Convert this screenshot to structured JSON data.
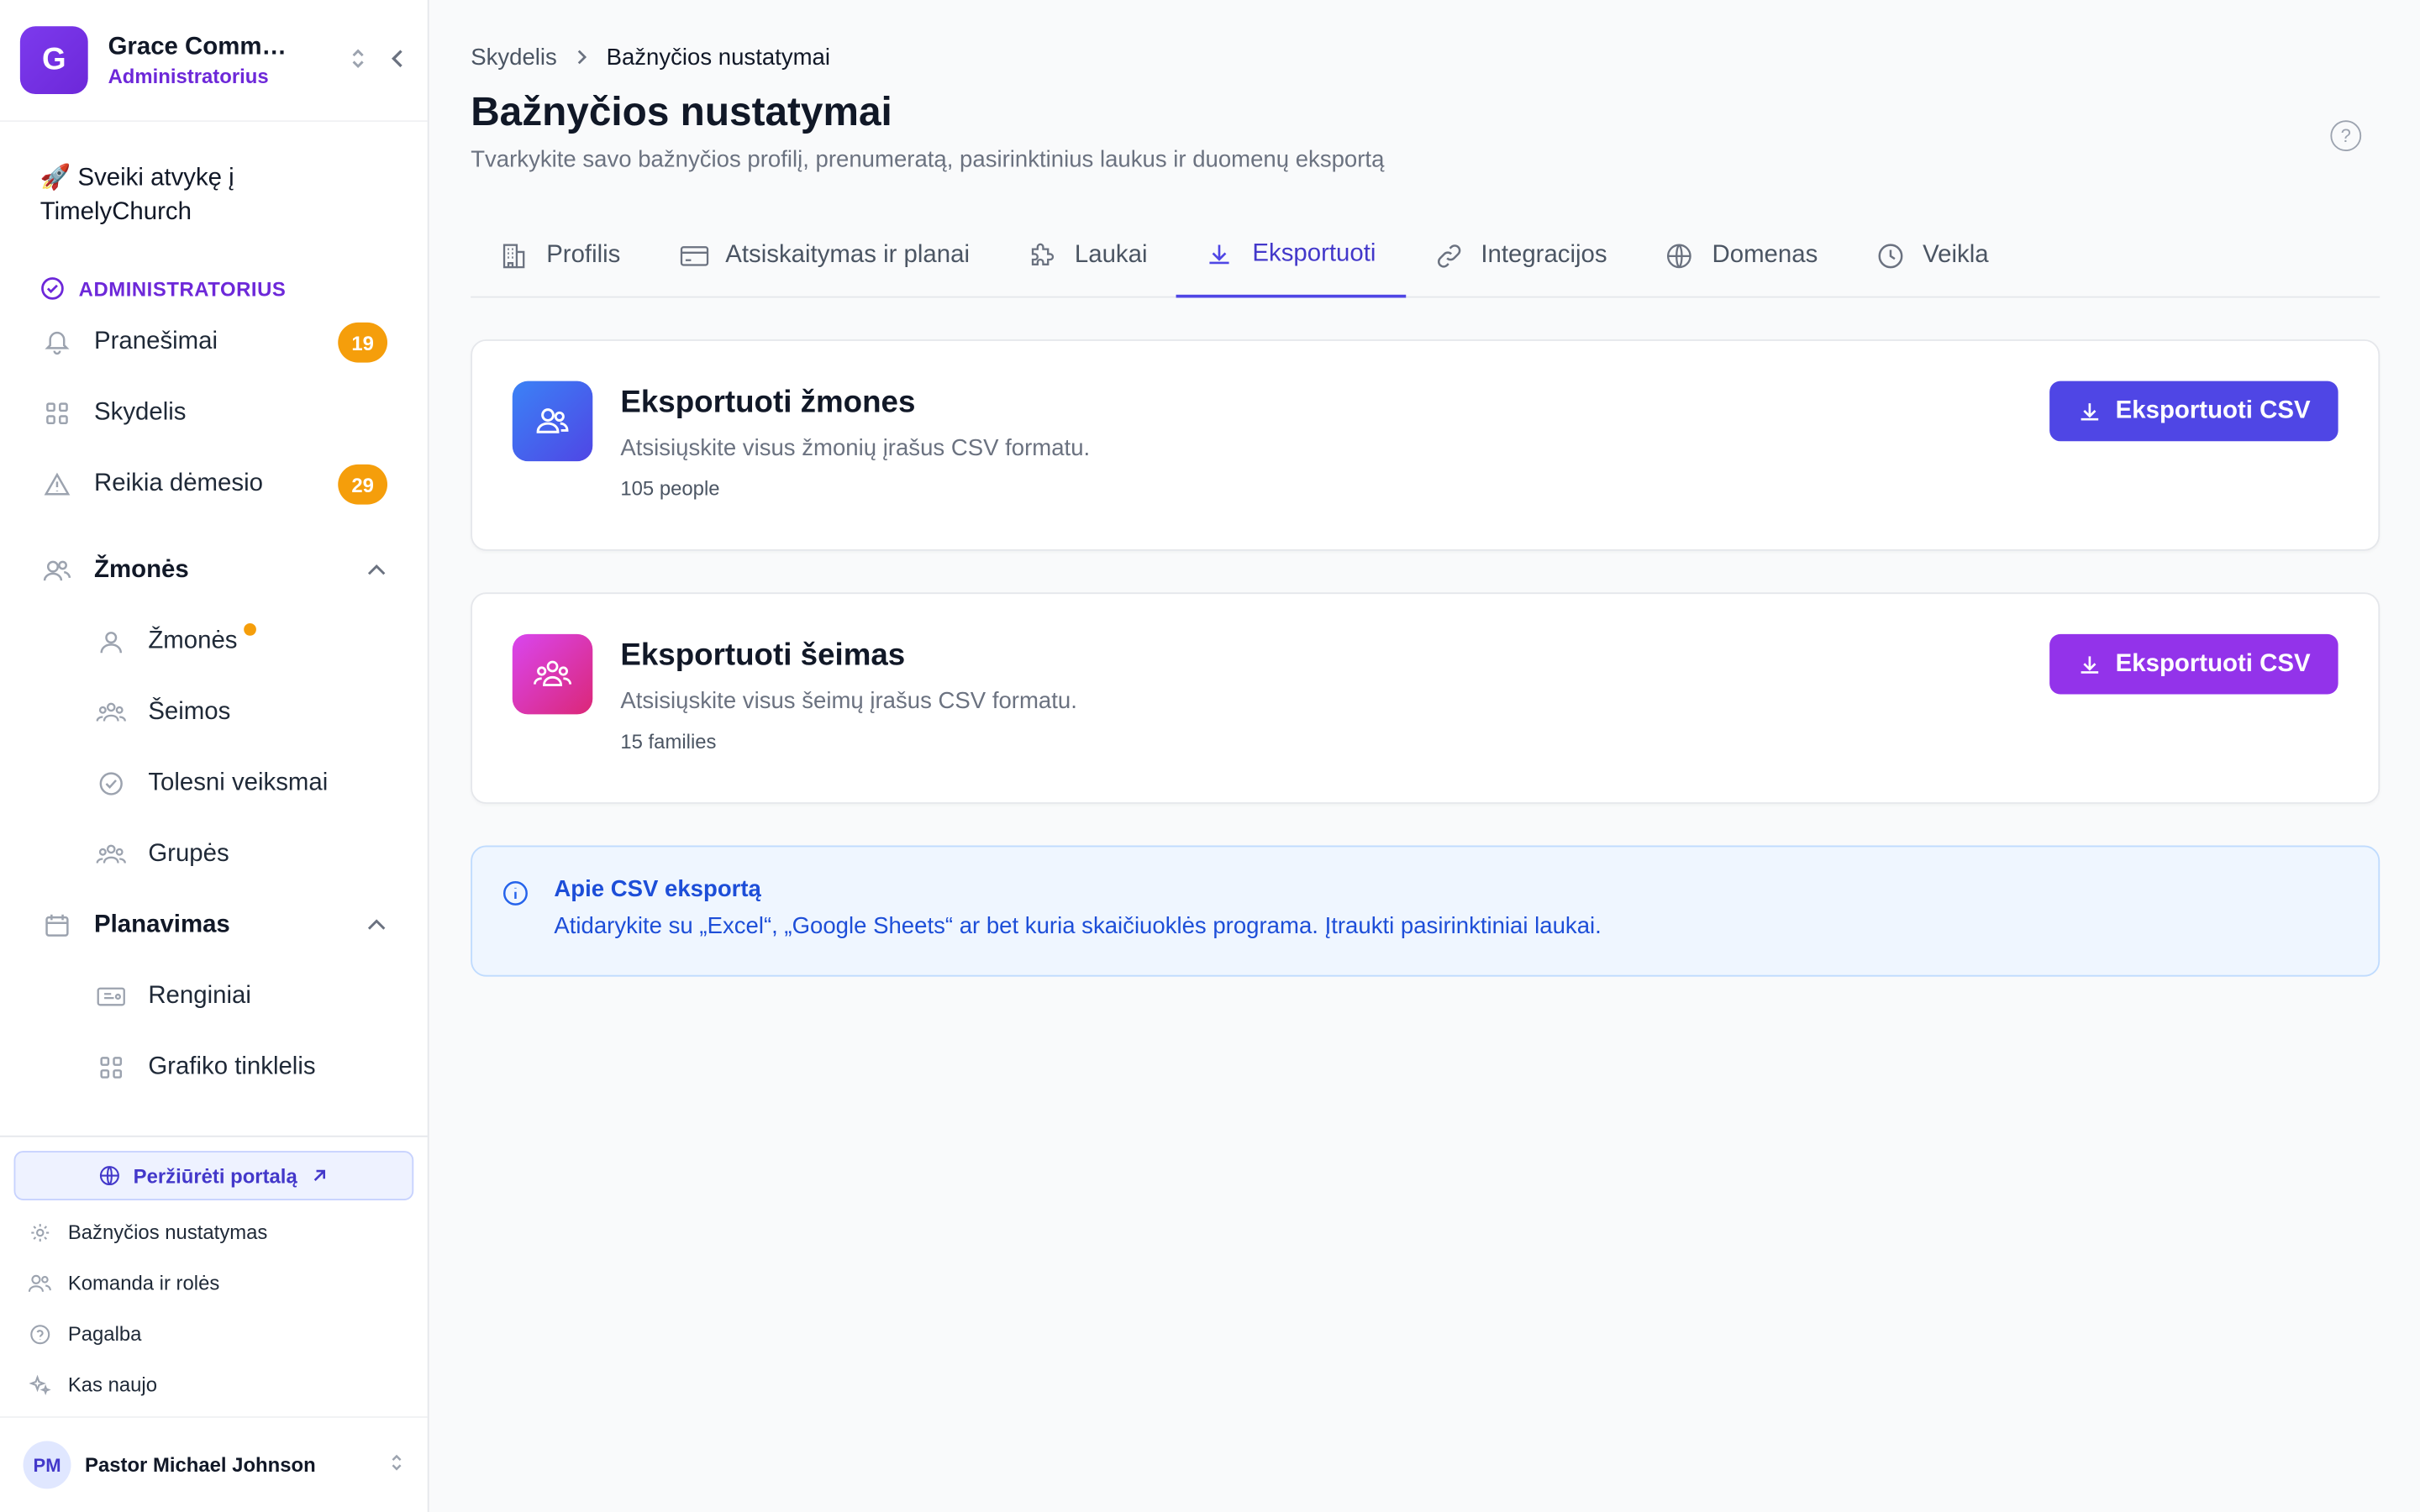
{
  "org": {
    "initial": "G",
    "name": "Grace Community Church",
    "role": "Administratorius"
  },
  "sidebar": {
    "welcome_line1": "🚀 Sveiki atvykę į",
    "welcome_line2": "TimelyChurch",
    "admin_label": "ADMINISTRATORIUS",
    "items": [
      {
        "label": "Pranešimai",
        "badge": "19"
      },
      {
        "label": "Skydelis"
      },
      {
        "label": "Reikia dėmesio",
        "badge": "29"
      }
    ],
    "people_group": "Žmonės",
    "people_items": [
      "Žmonės",
      "Šeimos",
      "Tolesni veiksmai",
      "Grupės"
    ],
    "planning_group": "Planavimas",
    "planning_items": [
      "Renginiai",
      "Grafiko tinklelis"
    ],
    "portal_button": "Peržiūrėti portalą",
    "footer_links": [
      "Bažnyčios nustatymas",
      "Komanda ir rolės",
      "Pagalba",
      "Kas naujo"
    ],
    "user": {
      "initials": "PM",
      "name": "Pastor Michael Johnson"
    }
  },
  "main": {
    "breadcrumb": {
      "parent": "Skydelis",
      "current": "Bažnyčios nustatymai"
    },
    "title": "Bažnyčios nustatymai",
    "subtitle": "Tvarkykite savo bažnyčios profilį, prenumeratą, pasirinktinius laukus ir duomenų eksportą",
    "tabs": [
      "Profilis",
      "Atsiskaitymas ir planai",
      "Laukai",
      "Eksportuoti",
      "Integracijos",
      "Domenas",
      "Veikla"
    ],
    "active_tab": "Eksportuoti",
    "cards": [
      {
        "title": "Eksportuoti žmones",
        "desc": "Atsisiųskite visus žmonių įrašus CSV formatu.",
        "count": "105 people",
        "button": "Eksportuoti CSV",
        "color": "#4f46e5"
      },
      {
        "title": "Eksportuoti šeimas",
        "desc": "Atsisiųskite visus šeimų įrašus CSV formatu.",
        "count": "15 families",
        "button": "Eksportuoti CSV",
        "color": "#9333ea"
      }
    ],
    "info": {
      "title": "Apie CSV eksportą",
      "text": "Atidarykite su „Excel“, „Google Sheets“ ar bet kuria skaičiuoklės programa. Įtraukti pasirinktiniai laukai."
    }
  },
  "colors": {
    "accent": "#4f46e5",
    "purple": "#9333ea",
    "badge": "#f59e0b",
    "info_blue": "#1d4ed8"
  }
}
